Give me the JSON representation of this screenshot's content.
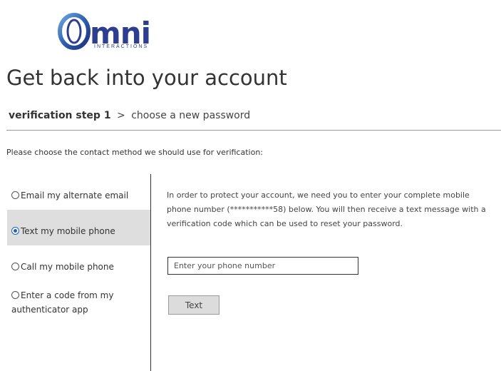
{
  "logo": {
    "word": "mni",
    "subtitle": "INTERACTIONS",
    "brand_color": "#2d3e8e"
  },
  "page_title": "Get back into your account",
  "steps": {
    "current": "verification step 1",
    "separator": ">",
    "next": "choose a new password"
  },
  "instruction": "Please choose the contact method we should use for verification:",
  "methods": [
    {
      "label": "Email my alternate email",
      "selected": false
    },
    {
      "label": "Text my mobile phone",
      "selected": true
    },
    {
      "label": "Call my mobile phone",
      "selected": false
    },
    {
      "label": "Enter a code from my authenticator app",
      "selected": false
    }
  ],
  "description": "In order to protect your account, we need you to enter your complete mobile phone number (***********58) below. You will then receive a text message with a verification code which can be used to reset your password.",
  "phone_input": {
    "value": "",
    "placeholder": "Enter your phone number"
  },
  "text_button_label": "Text",
  "colors": {
    "radio_selected": "#1e63b8",
    "selected_row_bg": "#dedede"
  }
}
